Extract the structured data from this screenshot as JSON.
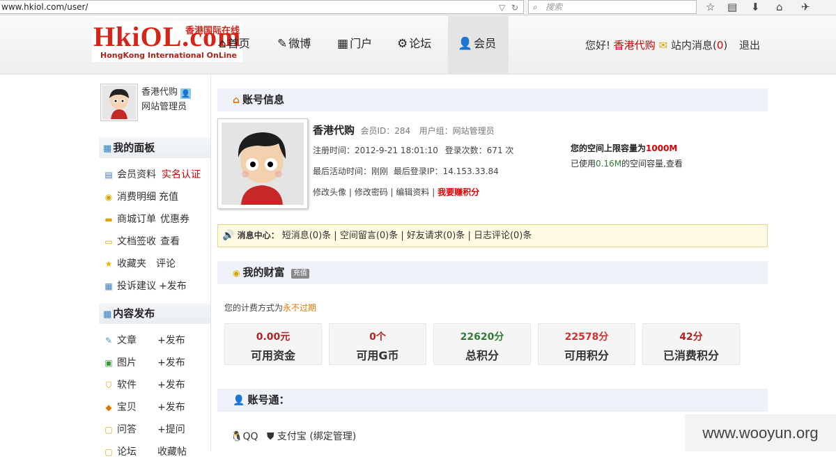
{
  "browser": {
    "url": "www.hkiol.com/user/",
    "search_placeholder": "搜索"
  },
  "header": {
    "logo": {
      "main": "HkiOL.com",
      "cn": "香港国际在线",
      "en": "HongKong International OnLine"
    },
    "nav": [
      {
        "label": "首页",
        "icon": "home-icon"
      },
      {
        "label": "微博",
        "icon": "pencil-icon"
      },
      {
        "label": "门户",
        "icon": "grid-icon"
      },
      {
        "label": "论坛",
        "icon": "gear-icon"
      },
      {
        "label": "会员",
        "icon": "user-icon",
        "active": true
      }
    ],
    "greeting": "您好!",
    "username": "香港代购",
    "messages_label": "站内消息(",
    "messages_count": "0",
    "messages_close": ")",
    "logout": "退出"
  },
  "sidebar": {
    "user_name": "香港代购",
    "user_role": "网站管理员",
    "panel_title": "我的面板",
    "panel_items": [
      {
        "label": "会员资料",
        "extra": "实名认证",
        "extra_red": true,
        "icon": "profile-icon"
      },
      {
        "label": "消费明细",
        "extra": "充值",
        "icon": "coins-icon"
      },
      {
        "label": "商城订单",
        "extra": "优惠券",
        "icon": "cart-icon"
      },
      {
        "label": "文档签收",
        "extra": "查看",
        "icon": "document-icon"
      },
      {
        "label": "收藏夹",
        "extra": "评论",
        "icon": "star-icon"
      },
      {
        "label": "投诉建议",
        "extra": "+发布",
        "icon": "calendar-icon"
      }
    ],
    "publish_title": "内容发布",
    "publish_items": [
      {
        "label": "文章",
        "extra": "+发布",
        "icon": "article-icon"
      },
      {
        "label": "图片",
        "extra": "+发布",
        "icon": "picture-icon"
      },
      {
        "label": "软件",
        "extra": "+发布",
        "icon": "software-icon"
      },
      {
        "label": "宝贝",
        "extra": "+发布",
        "icon": "tag-icon"
      },
      {
        "label": "问答",
        "extra": "+提问",
        "icon": "question-icon"
      },
      {
        "label": "论坛",
        "extra": "收藏帖",
        "icon": "forum-icon"
      }
    ]
  },
  "account": {
    "title": "账号信息",
    "name": "香港代购",
    "member_id_label": "会员ID：",
    "member_id": "284",
    "group_label": "用户组：",
    "group": "网站管理员",
    "register_label": "注册时间：",
    "register_time": "2012-9-21 18:01:10",
    "login_count_label": "登录次数：",
    "login_count": "671 次",
    "last_active_label": "最后活动时间：",
    "last_active": "刚刚",
    "last_ip_label": "最后登录IP：",
    "last_ip": "14.153.33.84",
    "links": [
      "修改头像",
      "修改密码",
      "编辑资料"
    ],
    "earn_points": "我要赚积分",
    "space_limit_label": "您的空间上限容量为",
    "space_limit": "1000M",
    "space_used_prefix": "已使用",
    "space_used": "0.16M",
    "space_used_suffix": "的空间容量,查看"
  },
  "message_center": {
    "label": "消息中心：",
    "items": [
      "短消息(0)条",
      "空间留言(0)条",
      "好友请求(0)条",
      "日志评论(0)条"
    ]
  },
  "wealth": {
    "title": "我的财富",
    "recharge_badge": "充值",
    "billing_prefix": "您的计费方式为",
    "billing_value": "永不过期",
    "stats": [
      {
        "value": "0.00元",
        "label": "可用资金",
        "color": "#b22222"
      },
      {
        "value": "0个",
        "label": "可用G币",
        "color": "#b22222"
      },
      {
        "value": "22620分",
        "label": "总积分",
        "color": "#2e7d32"
      },
      {
        "value": "22578分",
        "label": "可用积分",
        "color": "#d32f2f"
      },
      {
        "value": "42分",
        "label": "已消费积分",
        "color": "#b22222"
      }
    ]
  },
  "account_link": {
    "title": "账号通：",
    "qq": "QQ",
    "alipay": "支付宝 (绑定管理)"
  },
  "watermark": "www.wooyun.org"
}
